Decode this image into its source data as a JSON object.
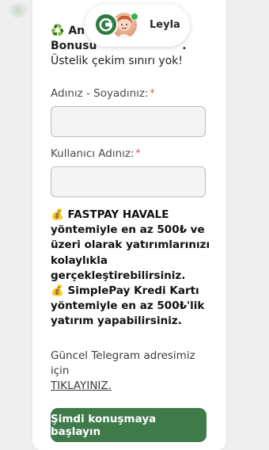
{
  "intro": {
    "icon": "recycle-icon",
    "line1_start": "An",
    "line2_start": "Bonusu",
    "line2_end": ".",
    "line3": "Üstelik çekim sınırı yok!"
  },
  "form": {
    "fullname_label": "Adınız - Soyadınız:",
    "username_label": "Kullanıcı Adınız:",
    "required_mark": "*",
    "fullname_value": "",
    "username_value": ""
  },
  "info": {
    "icon": "money-bag-icon",
    "fastpay_text": "FASTPAY HAVALE yöntemiyle en az 500₺ ve üzeri olarak yatırımlarınızı kolaylıkla gerçekleştirebilirsiniz.",
    "simplepay_text": "SimplePay Kredi Kartı yöntemiyle en az 500₺'lik yatırım yapabilirsiniz."
  },
  "telegram": {
    "text": "Güncel Telegram adresimiz için",
    "link": "TIKLAYINIZ."
  },
  "start_button": "Şimdi konuşmaya başlayın",
  "agent": {
    "name": "Leyla",
    "status": "online"
  },
  "colors": {
    "brand_green": "#3e7a4a",
    "logo_green": "#2f7a3e",
    "online_green": "#2db64c",
    "required_red": "#e05252"
  }
}
